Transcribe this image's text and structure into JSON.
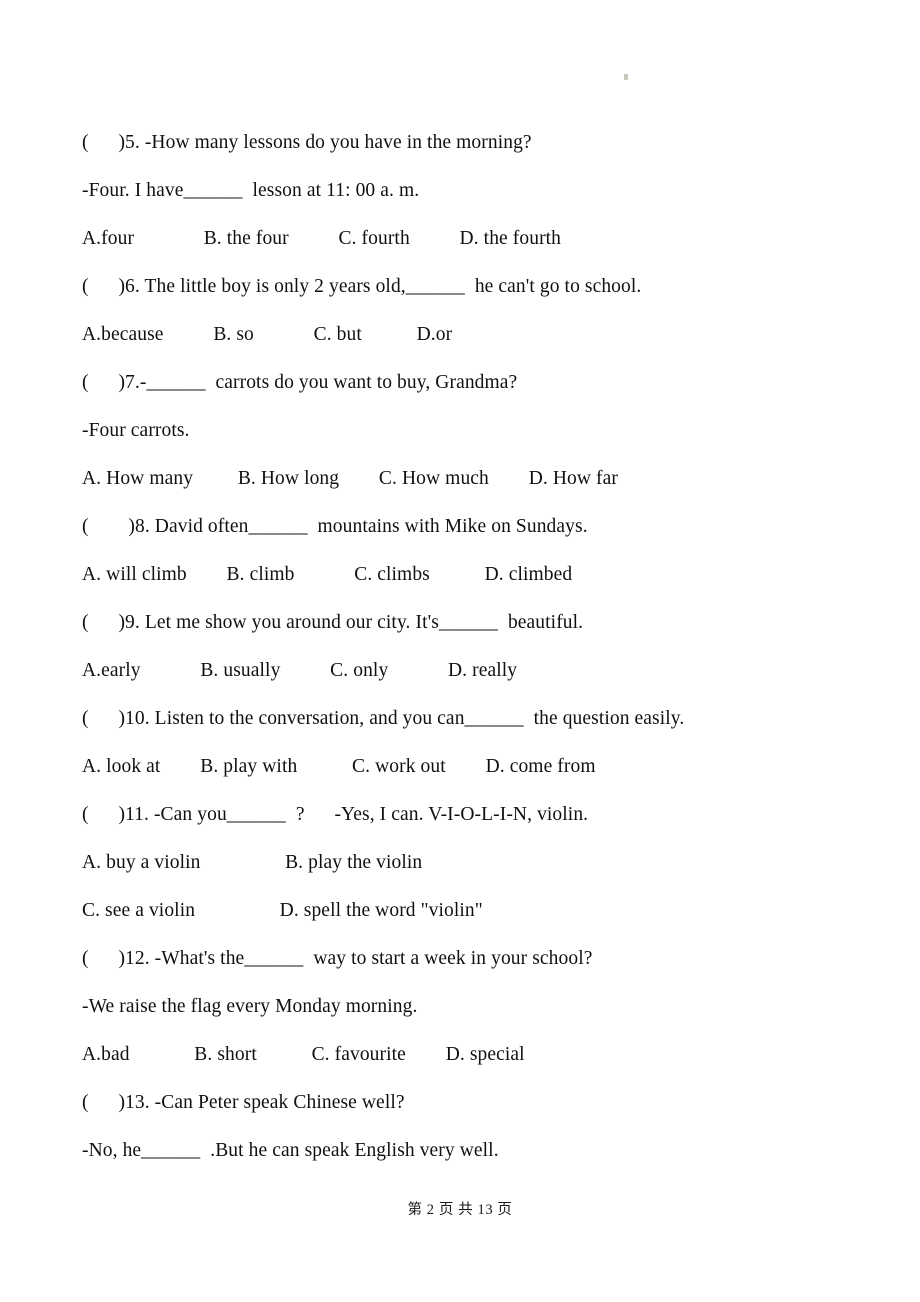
{
  "document": {
    "type": "exam-worksheet",
    "language": "English multiple-choice grammar test",
    "footer": "第 2 页 共 13 页",
    "page_number": "2",
    "total_pages": "13"
  },
  "lines": [
    {
      "id": "q5-stem",
      "text": "(      )5. -How many lessons do you have in the morning?"
    },
    {
      "id": "q5-reply",
      "text": "-Four. I have______  lesson at 11: 00 a. m."
    },
    {
      "id": "q5-options",
      "text": "A.four              B. the four          C. fourth          D. the fourth"
    },
    {
      "id": "q6-stem",
      "text": "(      )6. The little boy is only 2 years old,______  he can't go to school."
    },
    {
      "id": "q6-options",
      "text": "A.because          B. so            C. but           D.or"
    },
    {
      "id": "q7-stem",
      "text": "(      )7.-______  carrots do you want to buy, Grandma?"
    },
    {
      "id": "q7-reply",
      "text": "-Four carrots."
    },
    {
      "id": "q7-options",
      "text": "A. How many         B. How long        C. How much        D. How far"
    },
    {
      "id": "q8-stem",
      "text": "(        )8. David often______  mountains with Mike on Sundays."
    },
    {
      "id": "q8-options",
      "text": "A. will climb        B. climb            C. climbs           D. climbed"
    },
    {
      "id": "q9-stem",
      "text": "(      )9. Let me show you around our city. It's______  beautiful."
    },
    {
      "id": "q9-options",
      "text": "A.early            B. usually          C. only            D. really"
    },
    {
      "id": "q10-stem",
      "text": "(      )10. Listen to the conversation, and you can______  the question easily."
    },
    {
      "id": "q10-options",
      "text": "A. look at        B. play with           C. work out        D. come from"
    },
    {
      "id": "q11-stem",
      "text": "(      )11. -Can you______  ?      -Yes, I can. V-I-O-L-I-N, violin."
    },
    {
      "id": "q11-options-ab",
      "text": "A. buy a violin                 B. play the violin"
    },
    {
      "id": "q11-options-cd",
      "text": "C. see a violin                 D. spell the word \"violin\""
    },
    {
      "id": "q12-stem",
      "text": "(      )12. -What's the______  way to start a week in your school?"
    },
    {
      "id": "q12-reply",
      "text": "-We raise the flag every Monday morning."
    },
    {
      "id": "q12-options",
      "text": "A.bad             B. short           C. favourite        D. special"
    },
    {
      "id": "q13-stem",
      "text": "(      )13. -Can Peter speak Chinese well?"
    },
    {
      "id": "q13-reply",
      "text": "-No, he______  .But he can speak English very well."
    }
  ]
}
